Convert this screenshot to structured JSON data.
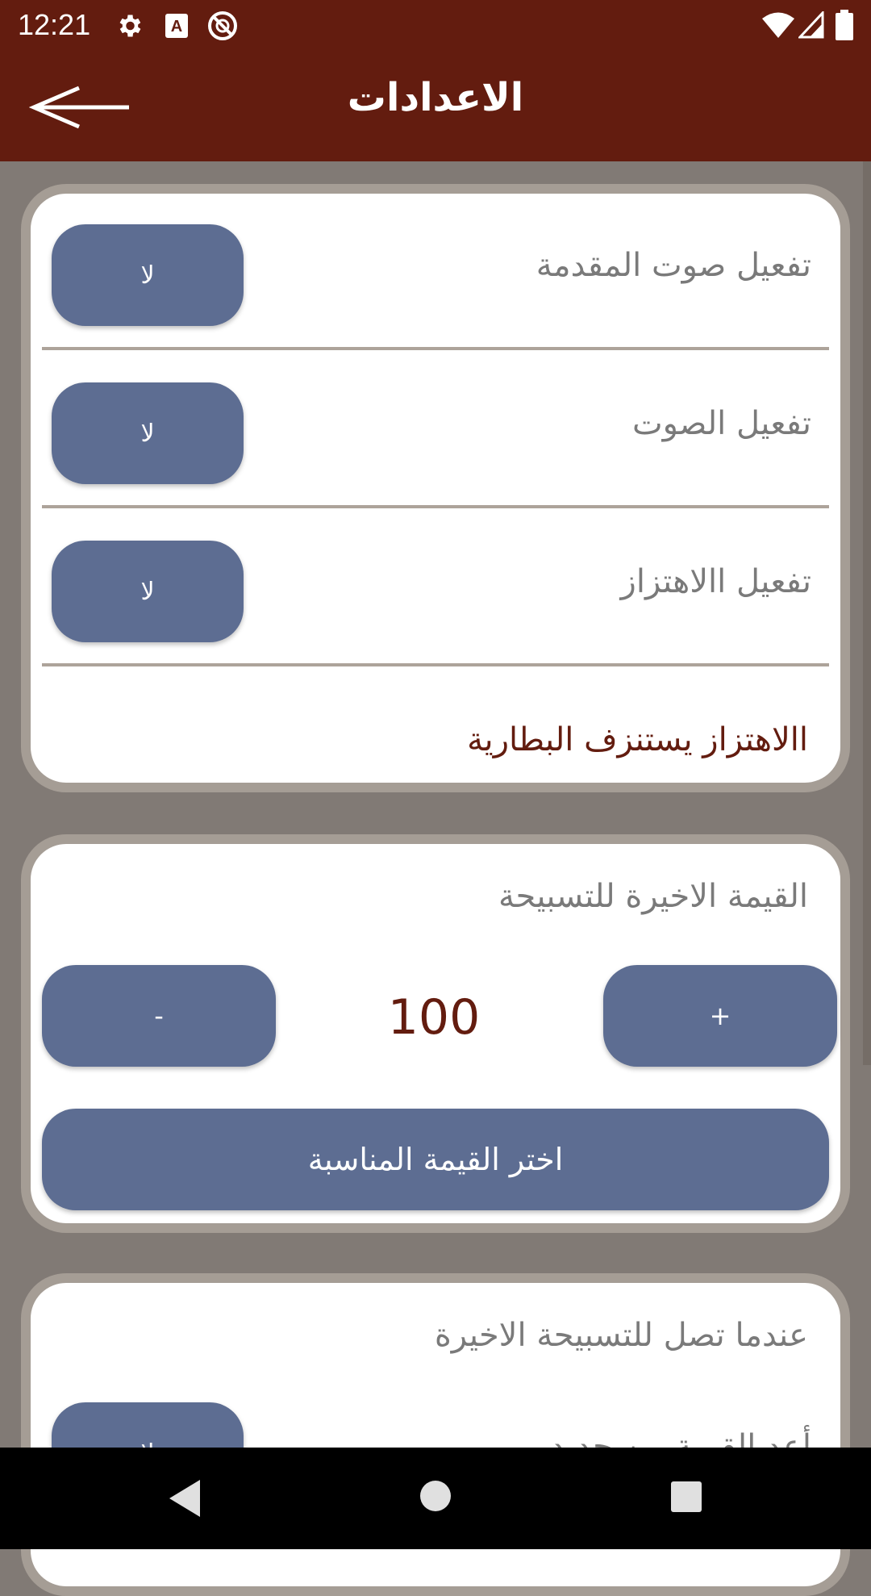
{
  "status_bar": {
    "time": "12:21",
    "icons": [
      "settings-icon",
      "a-notification-icon",
      "no-sync-icon",
      "wifi-icon",
      "signal-icon",
      "battery-icon"
    ]
  },
  "app_bar": {
    "title": "الاعدادات",
    "back_icon": "arrow-left-icon"
  },
  "sound_card": {
    "rows": [
      {
        "label": "تفعيل صوت المقدمة",
        "button": "لا"
      },
      {
        "label": "تفعيل الصوت",
        "button": "لا"
      },
      {
        "label": "تفعيل االاهتزاز",
        "button": "لا"
      }
    ],
    "warning": "االاهتزاز يستنزف البطارية"
  },
  "value_card": {
    "title": "القيمة الاخيرة للتسبيحة",
    "plus_label": "+",
    "minus_label": "-",
    "value": "100",
    "choose_label": "اختر القيمة المناسبة"
  },
  "end_card": {
    "title": "عندما تصل للتسبيحة الاخيرة",
    "row_label": "أعد القيمة من جديد",
    "row_button": "لا"
  },
  "colors": {
    "primary": "#631c0f",
    "button": "#5d6d92",
    "background": "#817a75"
  },
  "nav_bar": {
    "icons": [
      "back-triangle-icon",
      "home-circle-icon",
      "recents-square-icon"
    ]
  }
}
